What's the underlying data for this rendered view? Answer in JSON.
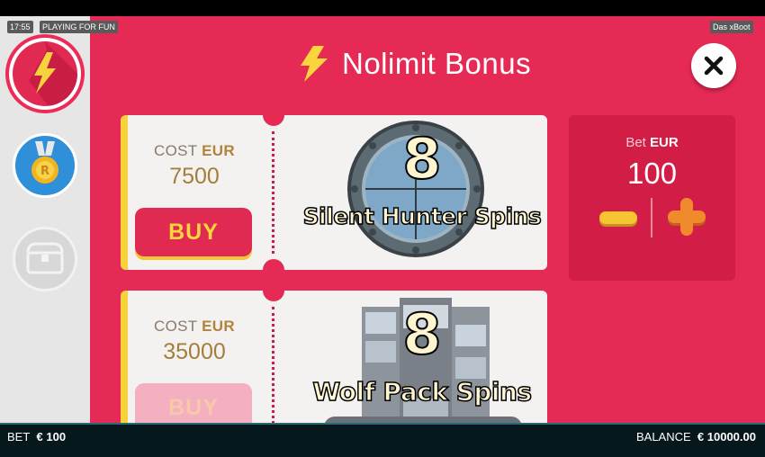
{
  "status": {
    "time": "17:55",
    "mode": "PLAYING FOR FUN",
    "game_name": "Das xBoot"
  },
  "sidebar": {
    "items": [
      {
        "icon": "lightning-icon",
        "active": true
      },
      {
        "icon": "medal-icon",
        "active": false
      },
      {
        "icon": "chest-icon",
        "active": false
      }
    ]
  },
  "header": {
    "title": "Nolimit Bonus",
    "icon": "lightning-icon",
    "close_icon": "close-icon"
  },
  "offers": [
    {
      "cost_label": "COST",
      "currency": "EUR",
      "cost": "7500",
      "buy_label": "BUY",
      "enabled": true,
      "feature_count": "8",
      "feature_name": "Silent Hunter Spins"
    },
    {
      "cost_label": "COST",
      "currency": "EUR",
      "cost": "35000",
      "buy_label": "BUY",
      "enabled": false,
      "feature_count": "8",
      "feature_name": "Wolf Pack Spins"
    }
  ],
  "bet_panel": {
    "label": "Bet",
    "currency": "EUR",
    "value": "100"
  },
  "footer": {
    "bet_label": "BET",
    "bet_value": "€ 100",
    "balance_label": "BALANCE",
    "balance_value": "€ 10000.00"
  },
  "colors": {
    "panel": "#e52a55",
    "accent_yellow": "#f6d23b",
    "buy_text": "#fad53c",
    "plus": "#f08a2d",
    "minus": "#f6c531"
  }
}
